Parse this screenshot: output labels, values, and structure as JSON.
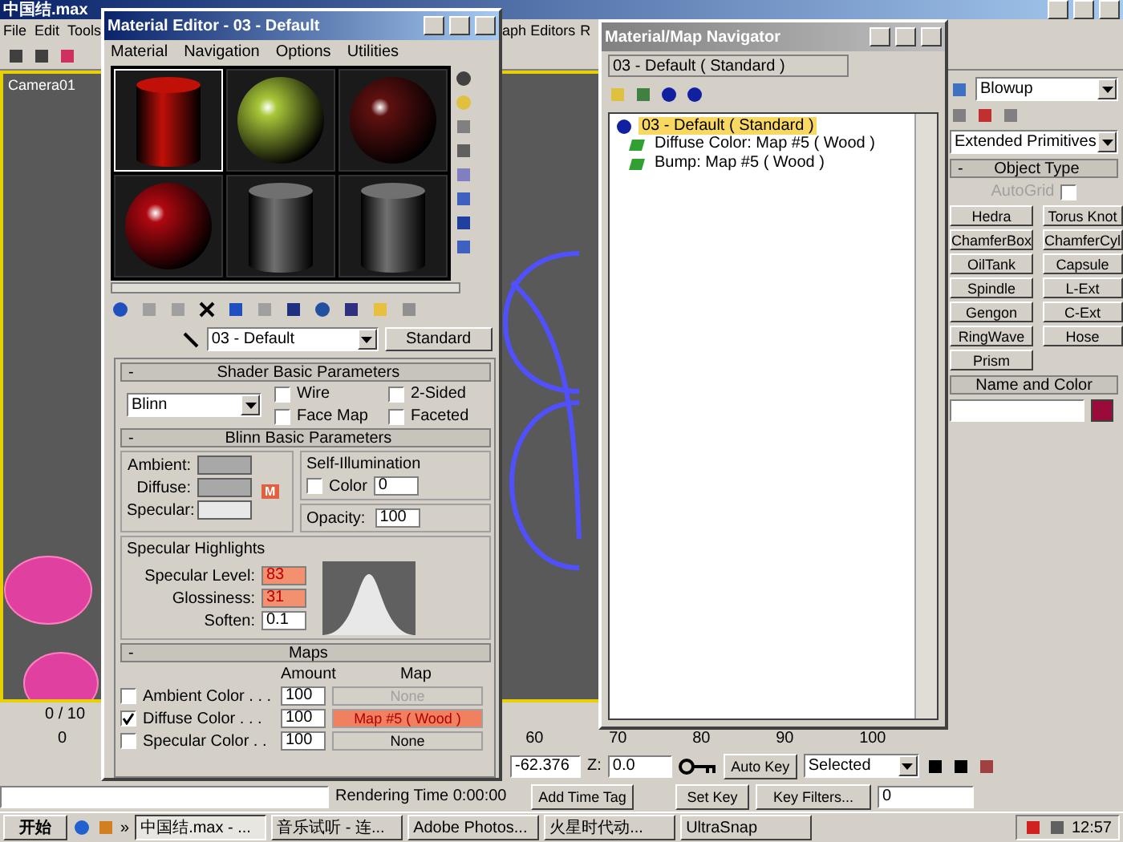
{
  "app": {
    "title": "中国结.max",
    "menu": {
      "left": [
        "File",
        "Edit",
        "Tools"
      ],
      "right": [
        "aph Editors",
        "R"
      ]
    },
    "viewport_label": "Camera01"
  },
  "command_panel": {
    "modifier_list": "Blowup",
    "category": "Extended Primitives",
    "object_type": {
      "toggle": "-",
      "title": "Object Type",
      "autogrid": {
        "label": "AutoGrid",
        "checked": false,
        "disabled": true
      },
      "buttons": [
        "Hedra",
        "Torus Knot",
        "ChamferBox",
        "ChamferCyl",
        "OilTank",
        "Capsule",
        "Spindle",
        "L-Ext",
        "Gengon",
        "C-Ext",
        "RingWave",
        "Hose",
        "Prism"
      ]
    },
    "name_color": {
      "title": "Name and Color",
      "color": "#9a0a3a"
    }
  },
  "time_slider": {
    "label": "0 / 10"
  },
  "track": {
    "start": "0",
    "ticks": [
      "60",
      "70",
      "80",
      "90",
      "100"
    ]
  },
  "status": {
    "x_value": "-62.376",
    "z_label": "Z:",
    "z_value": "0.0",
    "rendering_time": "Rendering Time  0:00:00",
    "add_time_tag": "Add Time Tag",
    "auto_key": "Auto Key",
    "set_key": "Set Key",
    "key_mode": "Selected",
    "key_filters": "Key Filters...",
    "frame": "0"
  },
  "taskbar": {
    "start": "开始",
    "more": "»",
    "tasks": [
      {
        "label": "中国结.max - ...",
        "selected": true
      },
      {
        "label": "音乐试听 - 连...",
        "selected": false
      },
      {
        "label": "Adobe Photos...",
        "selected": false
      },
      {
        "label": "火星时代动...",
        "selected": false
      },
      {
        "label": "UltraSnap",
        "selected": false
      }
    ],
    "clock": "12:57"
  },
  "material_editor": {
    "title": "Material Editor - 03 - Default",
    "menu": [
      "Material",
      "Navigation",
      "Options",
      "Utilities"
    ],
    "samples": [
      {
        "kind": "cylinder",
        "color": "#c01008",
        "selected": true
      },
      {
        "kind": "sphere",
        "color": "#a8c838",
        "selected": false
      },
      {
        "kind": "sphere",
        "color": "#601010",
        "selected": false
      },
      {
        "kind": "sphere",
        "color": "#b00810",
        "selected": false
      },
      {
        "kind": "cylinder",
        "color": "#707070",
        "selected": false
      },
      {
        "kind": "cylinder",
        "color": "#707070",
        "selected": false
      }
    ],
    "material_name": "03 - Default",
    "material_type": "Standard",
    "shader": {
      "toggle": "-",
      "title": "Shader Basic Parameters",
      "shader": "Blinn",
      "options": [
        {
          "label": "Wire",
          "checked": false
        },
        {
          "label": "2-Sided",
          "checked": false
        },
        {
          "label": "Face Map",
          "checked": false
        },
        {
          "label": "Faceted",
          "checked": false
        }
      ]
    },
    "blinn": {
      "toggle": "-",
      "title": "Blinn Basic Parameters",
      "colors": [
        {
          "label": "Ambient:"
        },
        {
          "label": "Diffuse:"
        },
        {
          "label": "Specular:"
        }
      ],
      "map_marker": "M",
      "self_illumination": {
        "title": "Self-Illumination",
        "label": "Color",
        "checked": false,
        "value": "0"
      },
      "opacity": {
        "label": "Opacity:",
        "value": "100"
      }
    },
    "specular": {
      "title": "Specular Highlights",
      "fields": [
        {
          "label": "Specular Level:",
          "value": "83",
          "highlighted": true
        },
        {
          "label": "Glossiness:",
          "value": "31",
          "highlighted": true
        },
        {
          "label": "Soften:",
          "value": "0.1",
          "highlighted": false
        }
      ]
    },
    "maps": {
      "toggle": "-",
      "title": "Maps",
      "amount_header": "Amount",
      "map_header": "Map",
      "rows": [
        {
          "label": "Ambient Color . . .",
          "checked": false,
          "amount": "100",
          "map": "None",
          "disabled": true,
          "highlighted": false
        },
        {
          "label": "Diffuse Color . . .",
          "checked": true,
          "amount": "100",
          "map": "Map #5  ( Wood )",
          "disabled": false,
          "highlighted": true
        },
        {
          "label": "Specular Color . .",
          "checked": false,
          "amount": "100",
          "map": "None",
          "disabled": false,
          "highlighted": false
        }
      ]
    }
  },
  "navigator": {
    "title": "Material/Map Navigator",
    "path": "03 - Default  ( Standard )",
    "tree": [
      {
        "label": "03 - Default  ( Standard )",
        "kind": "material",
        "selected": true,
        "children": [
          {
            "label": "Diffuse Color: Map #5  ( Wood )",
            "kind": "map",
            "selected": false
          },
          {
            "label": "Bump: Map #5  ( Wood )",
            "kind": "map",
            "selected": false
          }
        ]
      }
    ]
  }
}
